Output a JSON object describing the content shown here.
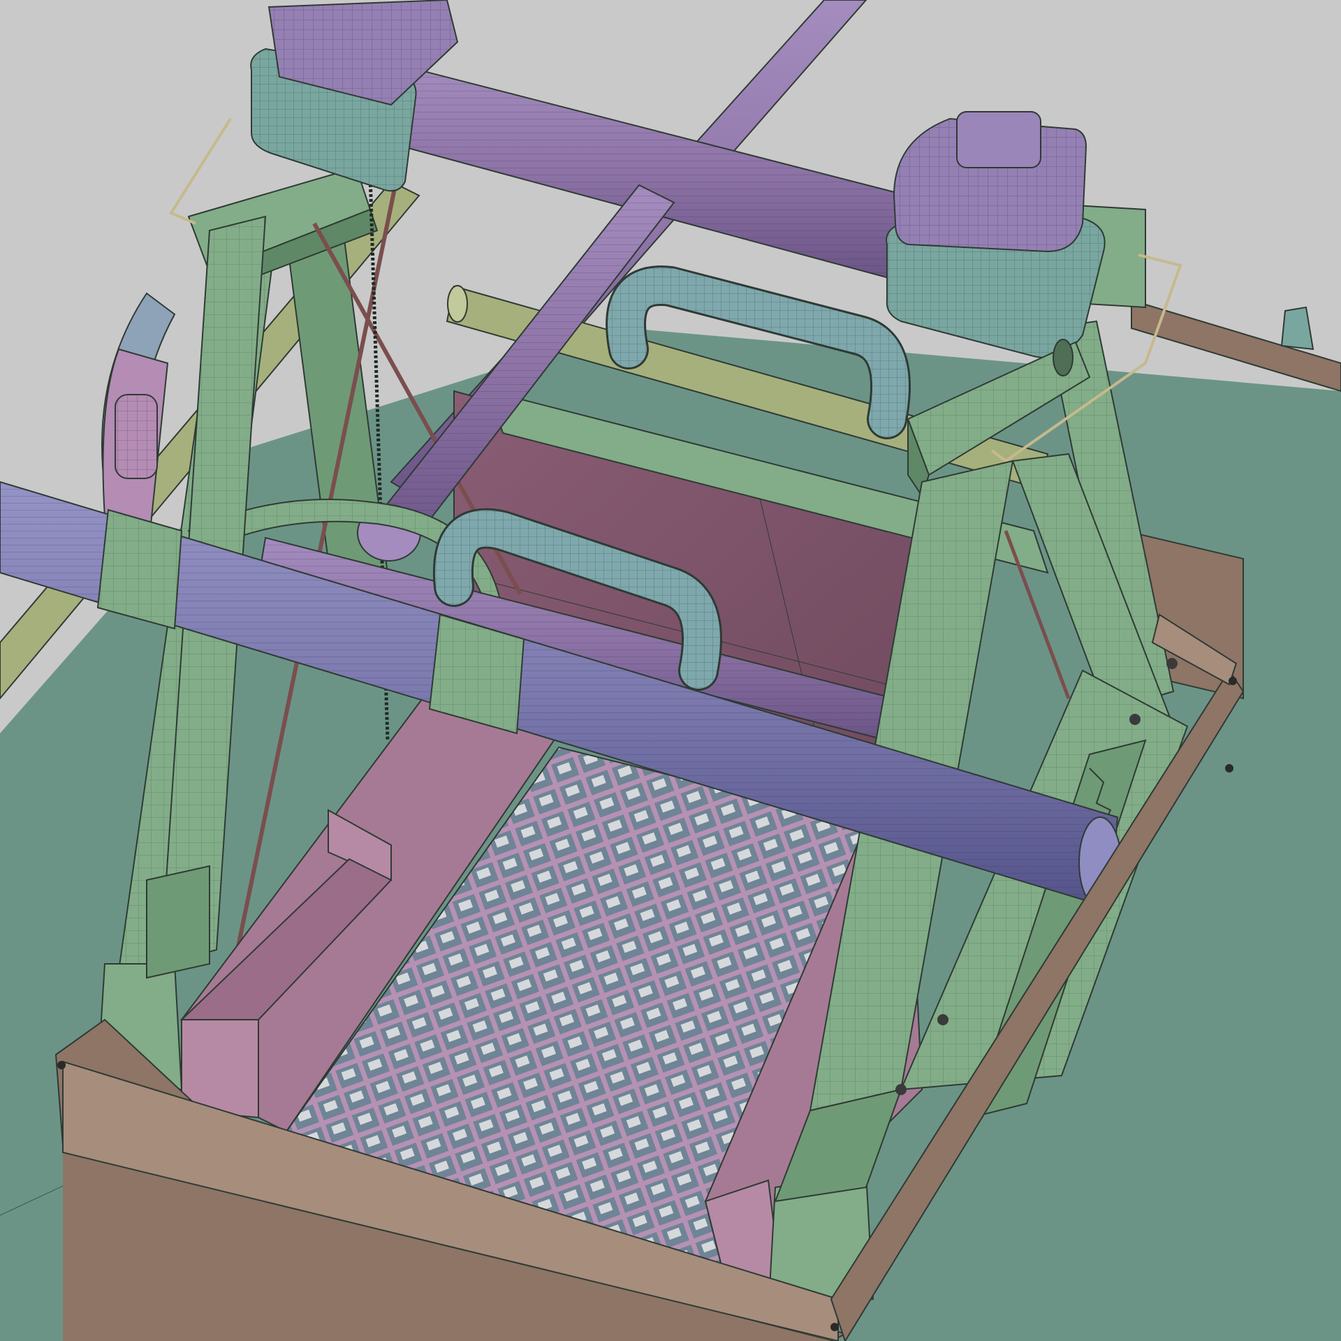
{
  "colors": {
    "background": "#c9c9c9",
    "ground": "#6b9487",
    "ground_dark": "#5c8376",
    "frame_green": "#82ad88",
    "frame_green_dark": "#5f8866",
    "frame_green_light": "#a0c6a2",
    "bar_purple": "#8d73a6",
    "bar_purple_dark": "#6b5486",
    "bar_blue": "#7b79ad",
    "bar_blue_dark": "#5b5a8c",
    "cap_purple": "#9480b3",
    "clamp_teal": "#7aa6a0",
    "handle_teal": "#7fa8ad",
    "hopper_pink": "#a67a94",
    "hopper_pink_dark": "#7f566e",
    "hopper_back": "#87586e",
    "grate_blue": "#6f8496",
    "grate_pink": "#b691b4",
    "grate_white": "#e8e8e8",
    "tray_tan": "#8e7566",
    "tray_tan_light": "#a78d7c",
    "rod_olive": "#a6b07c",
    "wheel_blue": "#8ea2b8",
    "wheel_pink": "#b48cb4",
    "cable_red": "#7b4e4e",
    "wire_tan": "#c6b98c"
  },
  "icons": {
    "model": "3d-wireframe-sieve-machine"
  }
}
